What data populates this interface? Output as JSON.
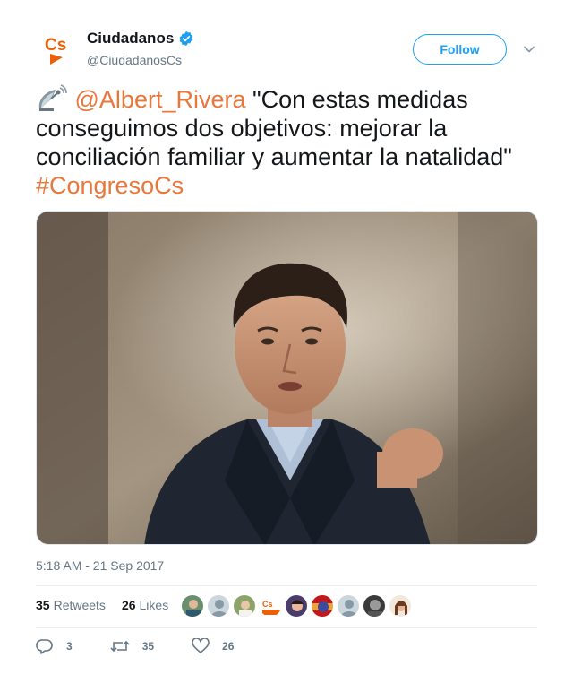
{
  "account": {
    "name": "Ciudadanos",
    "handle": "@CiudadanosCs",
    "avatar_text": "Cs",
    "avatar_color": "#eb6109",
    "verified_color": "#1da1f2"
  },
  "header": {
    "follow_label": "Follow",
    "menu_icon": "chevron-down-icon"
  },
  "tweet": {
    "emoji_icon": "satellite-antenna-icon",
    "mention": "@Albert_Rivera",
    "body": " \"Con estas medidas conseguimos dos objetivos: mejorar la conciliación familiar y aumentar la natalidad\" ",
    "hashtag": "#CongresoCs",
    "link_color": "#e8773b",
    "timestamp": "5:18 AM - 21 Sep 2017"
  },
  "stats": {
    "retweets_count": "35",
    "retweets_label": "Retweets",
    "likes_count": "26",
    "likes_label": "Likes"
  },
  "actions": {
    "reply_count": "3",
    "retweet_count": "35",
    "like_count": "26"
  }
}
